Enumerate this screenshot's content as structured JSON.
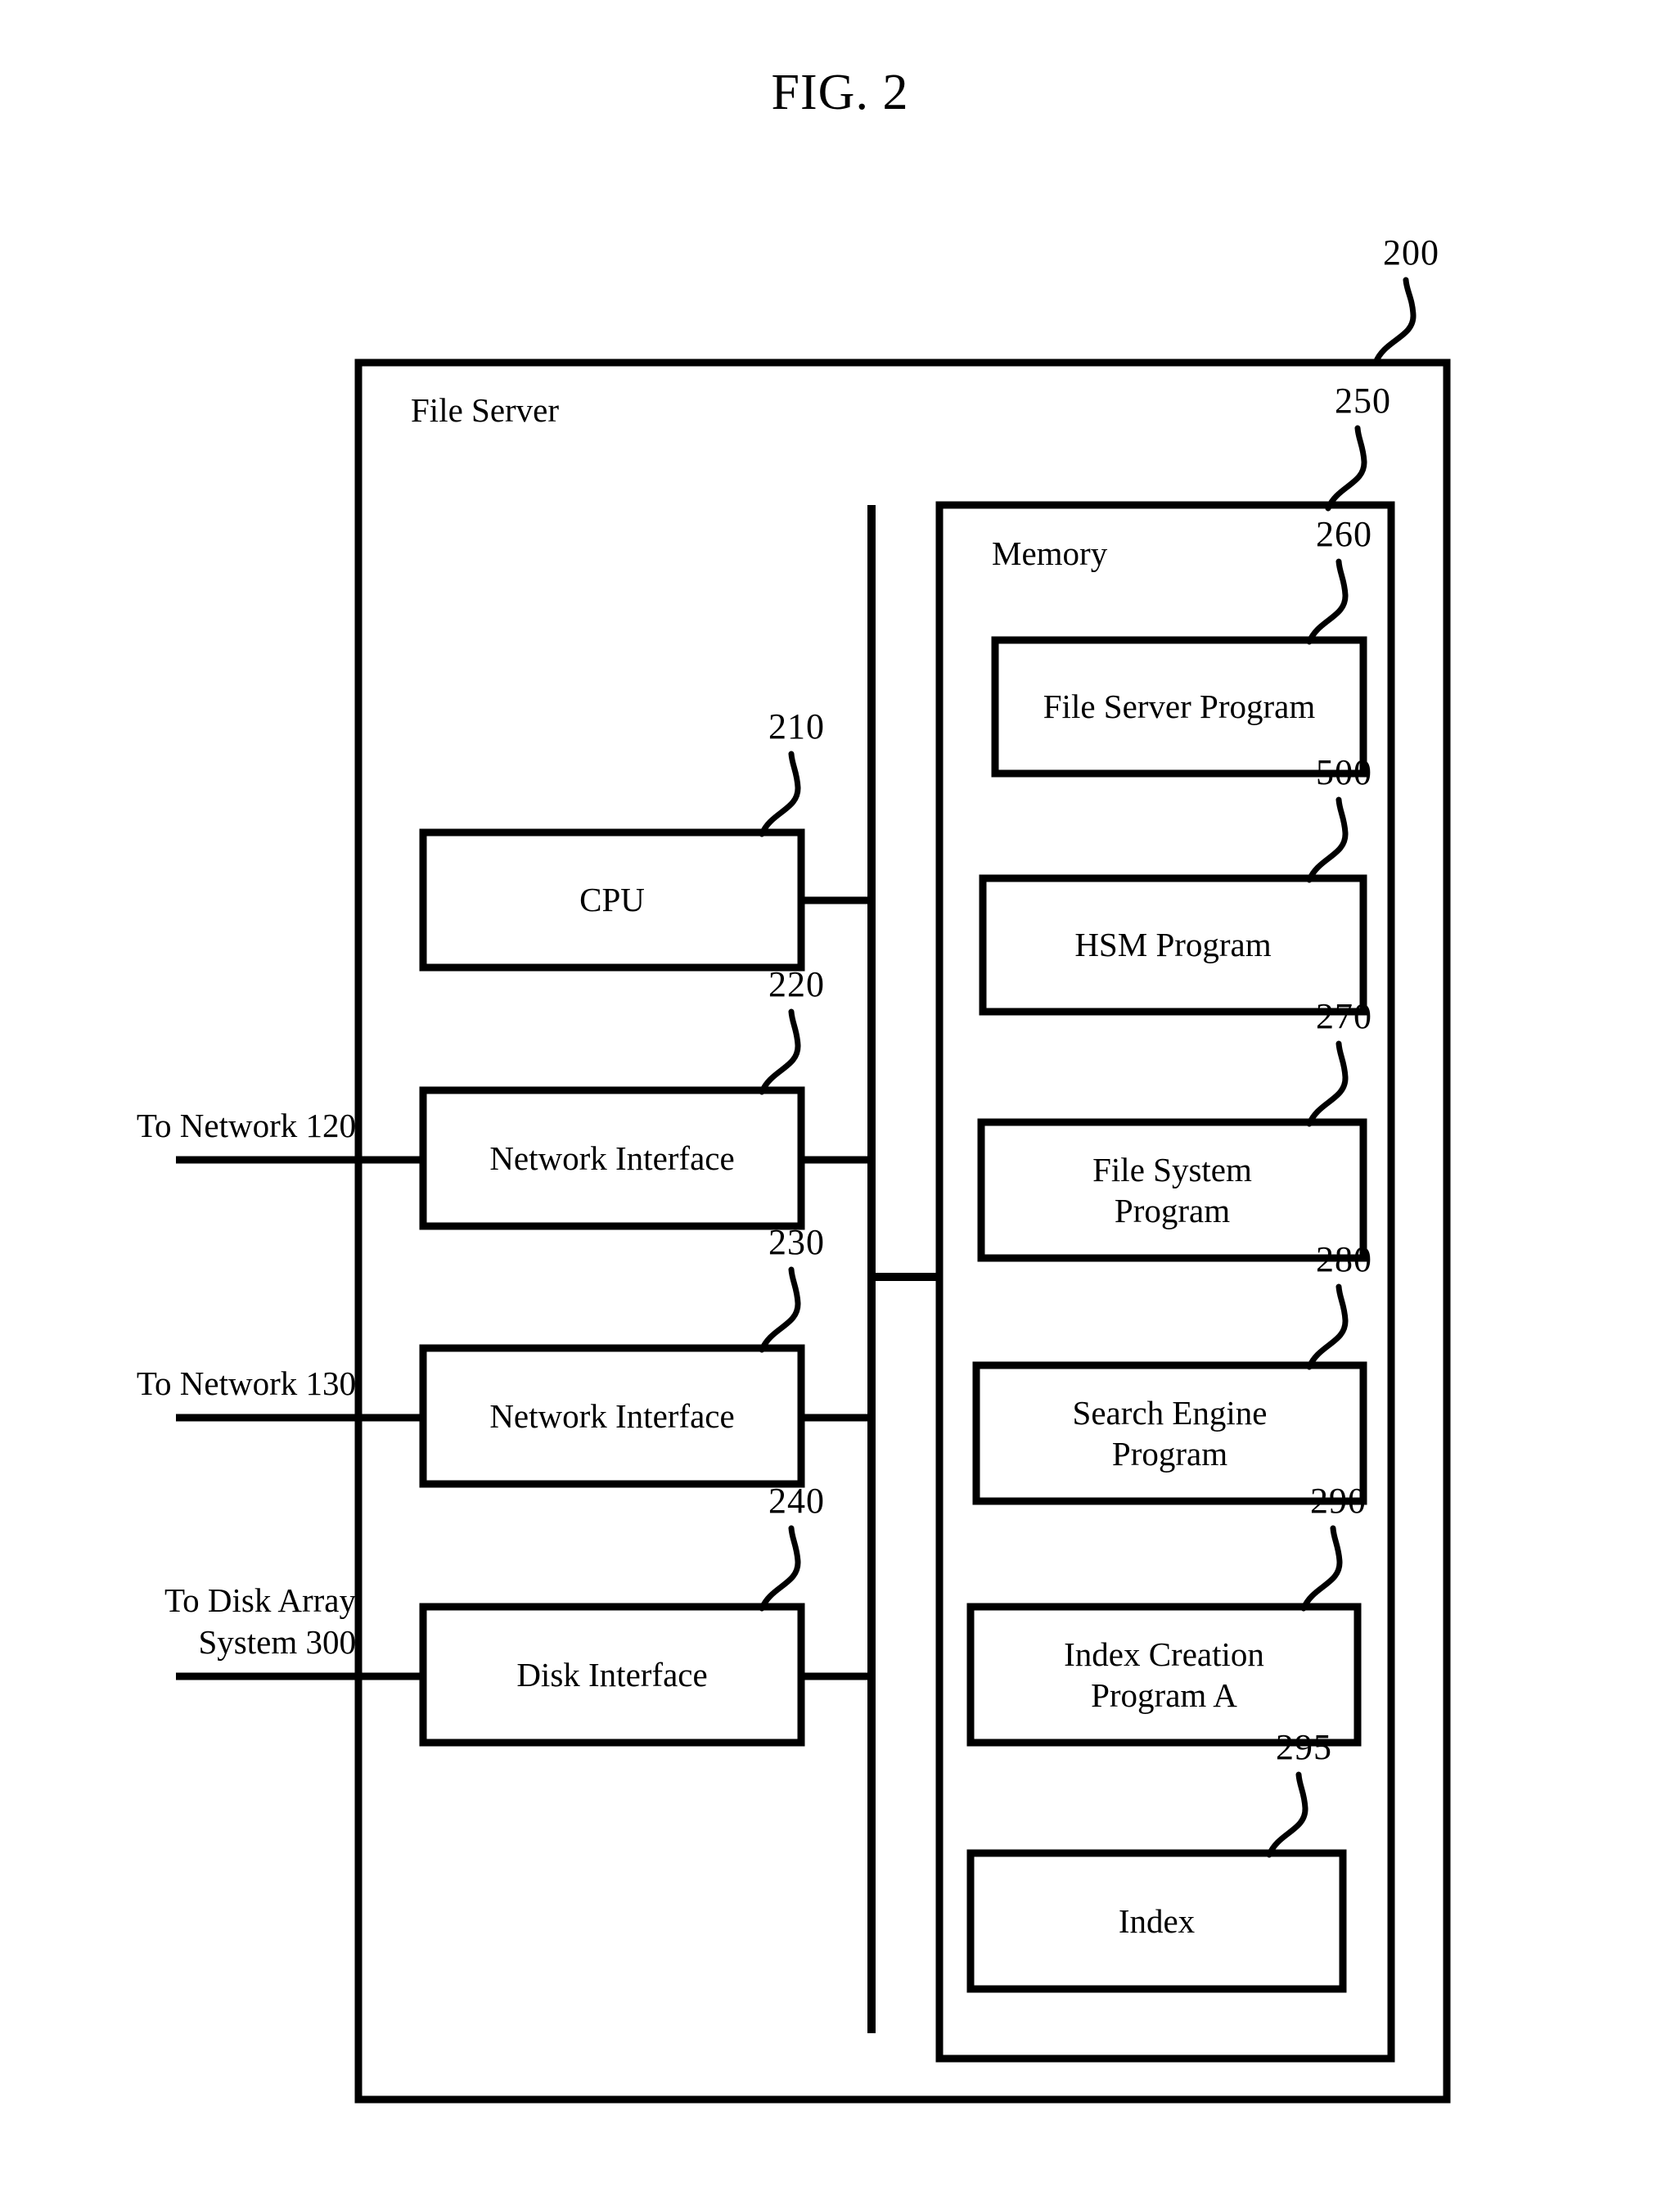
{
  "figure": {
    "title": "FIG. 2",
    "outer_ref": "200",
    "outer_label": "File Server"
  },
  "hardware": [
    {
      "label": "CPU",
      "ref": "210"
    },
    {
      "label": "Network Interface",
      "ref": "220"
    },
    {
      "label": "Network Interface",
      "ref": "230"
    },
    {
      "label": "Disk Interface",
      "ref": "240"
    }
  ],
  "external_links": [
    {
      "text": "To Network 120"
    },
    {
      "text": "To Network 130"
    },
    {
      "text": "To Disk Array\nSystem 300"
    }
  ],
  "memory": {
    "label": "Memory",
    "ref": "250",
    "items": [
      {
        "label": "File Server Program",
        "ref": "260"
      },
      {
        "label": "HSM Program",
        "ref": "500"
      },
      {
        "label": "File System\nProgram",
        "ref": "270"
      },
      {
        "label": "Search Engine\nProgram",
        "ref": "280"
      },
      {
        "label": "Index Creation\nProgram A",
        "ref": "290"
      },
      {
        "label": "Index",
        "ref": "295"
      }
    ]
  },
  "colors": {
    "ink": "#000000",
    "paper": "#ffffff"
  }
}
